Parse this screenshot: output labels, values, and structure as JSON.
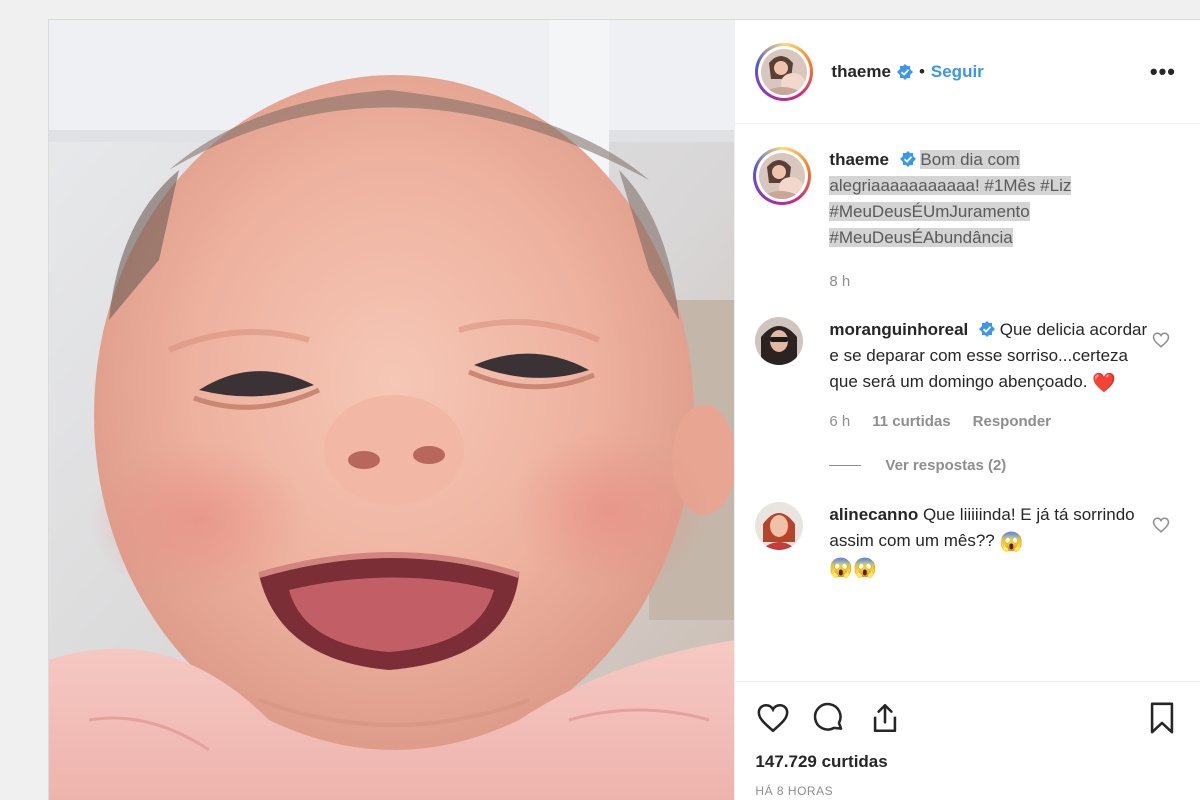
{
  "post": {
    "author": "thaeme",
    "dot": "•",
    "follow_label": "Seguir",
    "more_label": "•••",
    "caption": {
      "username": "thaeme",
      "text": "Bom dia com alegriaaaaaaaaaaa! #1Mês #Liz #MeuDeusÉUmJuramento #MeuDeusÉAbundância",
      "age": "8 h"
    },
    "comments": [
      {
        "username": "moranguinhoreal",
        "verified": true,
        "text": "Que delicia acordar e se deparar com esse sorriso...certeza que será um domingo abençoado.",
        "emoji": "❤️",
        "age": "6 h",
        "likes": "11 curtidas",
        "reply_label": "Responder",
        "view_replies": "Ver respostas (2)"
      },
      {
        "username": "alinecanno",
        "verified": false,
        "text": "Que liiiiinda! E já tá sorrindo assim com um mês??",
        "emoji": "😱",
        "emoji_line": "😱😱"
      }
    ],
    "likes_count": "147.729 curtidas",
    "timestamp": "HÁ 8 HORAS"
  },
  "colors": {
    "link_blue": "#3897f0",
    "verified_blue": "#3897f0",
    "heart_red": "#ed4956",
    "text": "#262626",
    "muted": "#8e8e8e"
  },
  "icons": [
    "verified-badge-icon",
    "more-options-icon",
    "heart-icon",
    "comment-icon",
    "share-icon",
    "bookmark-icon"
  ]
}
